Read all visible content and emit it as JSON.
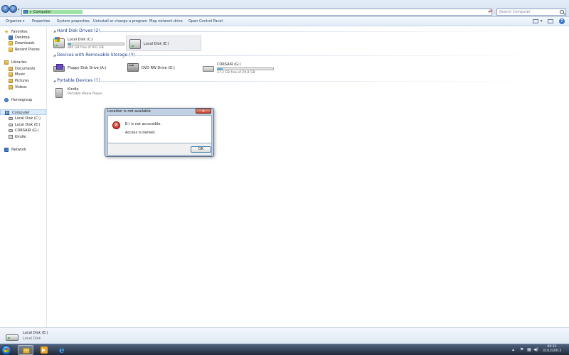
{
  "address": {
    "path": "Computer",
    "separator": "▸",
    "search_placeholder": "Search Computer"
  },
  "toolbar": {
    "organize": "Organize ▾",
    "properties": "Properties",
    "system_properties": "System properties",
    "uninstall": "Uninstall or change a program",
    "map_drive": "Map network drive",
    "control_panel": "Open Control Panel"
  },
  "sidebar": {
    "favorites": "Favorites",
    "desktop": "Desktop",
    "downloads": "Downloads",
    "recent": "Recent Places",
    "libraries": "Libraries",
    "documents": "Documents",
    "music": "Music",
    "pictures": "Pictures",
    "videos": "Videos",
    "homegroup": "Homegroup",
    "computer": "Computer",
    "disk_c": "Local Disk (C:)",
    "disk_e": "Local Disk (E:)",
    "corsair": "CORSAIR (G:)",
    "kindle": "Kindle",
    "network": "Network"
  },
  "groups": {
    "hdd": "Hard Disk Drives (2)",
    "removable": "Devices with Removable Storage (3)",
    "portable": "Portable Devices (1)"
  },
  "drives": {
    "c": {
      "name": "Local Disk (C:)",
      "info": "885 GB free of 931 GB",
      "used_fraction": 0.05
    },
    "e": {
      "name": "Local Disk (E:)"
    },
    "floppy": {
      "name": "Floppy Disk Drive (A:)"
    },
    "dvd": {
      "name": "DVD RW Drive (D:)"
    },
    "g": {
      "name": "CORSAIR (G:)",
      "info": "27.2 GB free of 29.8 GB",
      "used_fraction": 0.09
    },
    "kindle": {
      "name": "Kindle",
      "info": "Portable Media Player"
    }
  },
  "dialog": {
    "title": "Location is not available",
    "close": "✕",
    "message": "E:\\ is not accessible.",
    "detail": "Access is denied.",
    "ok": "OK"
  },
  "details": {
    "name": "Local Disk (E:)",
    "type": "Local Disk"
  },
  "taskbar": {
    "time": "09:33",
    "date": "31/12/2013"
  },
  "colors": {
    "accent": "#1e3f87",
    "progress": "#1f9bd3",
    "error": "#c0180c"
  }
}
